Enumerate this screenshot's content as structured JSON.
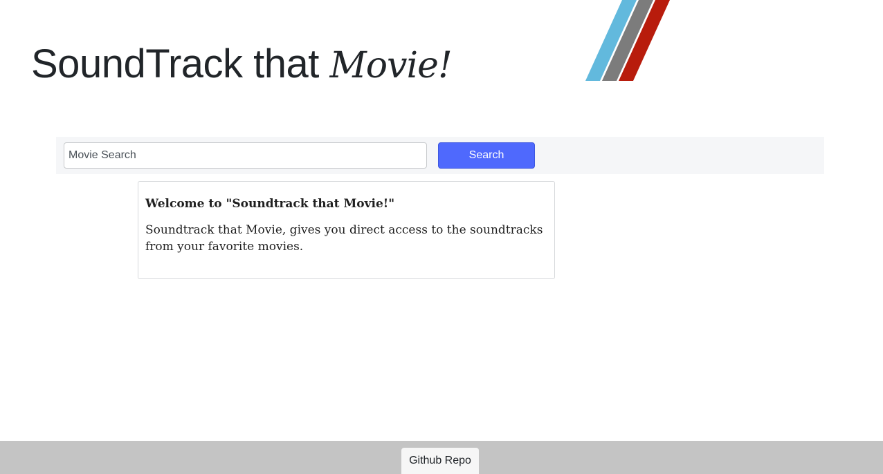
{
  "header": {
    "title_main": "SoundTrack that ",
    "title_accent": "Movie!",
    "logo_stripe_colors": [
      "#62b9dd",
      "#7c7c7c",
      "#b81c0c"
    ]
  },
  "search": {
    "placeholder": "Movie Search",
    "value": "",
    "button_label": "Search"
  },
  "welcome": {
    "heading": "Welcome to \"Soundtrack that Movie!\"",
    "body": "Soundtrack that Movie, gives you direct access to the soundtracks from your favorite movies."
  },
  "footer": {
    "github_label": "Github Repo"
  },
  "colors": {
    "accent": "#4f69fd",
    "footer_bg": "#c4c4c4",
    "search_bar_bg": "#f5f6f8"
  }
}
